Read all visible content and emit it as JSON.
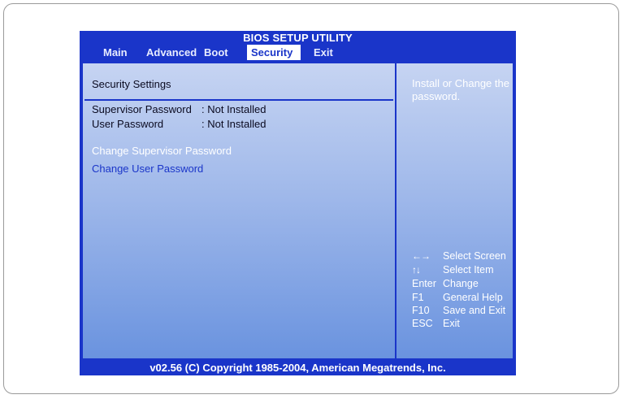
{
  "bios": {
    "title": "BIOS SETUP UTILITY",
    "menu": [
      {
        "label": "Main",
        "active": false
      },
      {
        "label": "Advanced",
        "active": false
      },
      {
        "label": "Boot",
        "active": false
      },
      {
        "label": "Security",
        "active": true
      },
      {
        "label": "Exit",
        "active": false
      }
    ],
    "section_title": "Security Settings",
    "status": [
      {
        "label": "Supervisor Password",
        "value": ": Not Installed"
      },
      {
        "label": "User Password",
        "value": ": Not Installed"
      }
    ],
    "options": [
      {
        "label": "Change Supervisor Password",
        "selected": true
      },
      {
        "label": "Change User Password",
        "selected": false
      }
    ],
    "help_text": "Install or Change the password.",
    "keys": [
      {
        "key": "←→",
        "action": "Select Screen",
        "icon": "left-right-arrows-icon"
      },
      {
        "key": "↑↓",
        "action": "Select Item",
        "icon": "up-down-arrows-icon"
      },
      {
        "key": "Enter",
        "action": "Change"
      },
      {
        "key": "F1",
        "action": "General Help"
      },
      {
        "key": "F10",
        "action": "Save and Exit"
      },
      {
        "key": "ESC",
        "action": "Exit"
      }
    ],
    "footer": "v02.56 (C) Copyright  1985-2004, American Megatrends, Inc.",
    "colors": {
      "primary_blue": "#1a35c9",
      "highlight_white": "#ffffff"
    }
  }
}
